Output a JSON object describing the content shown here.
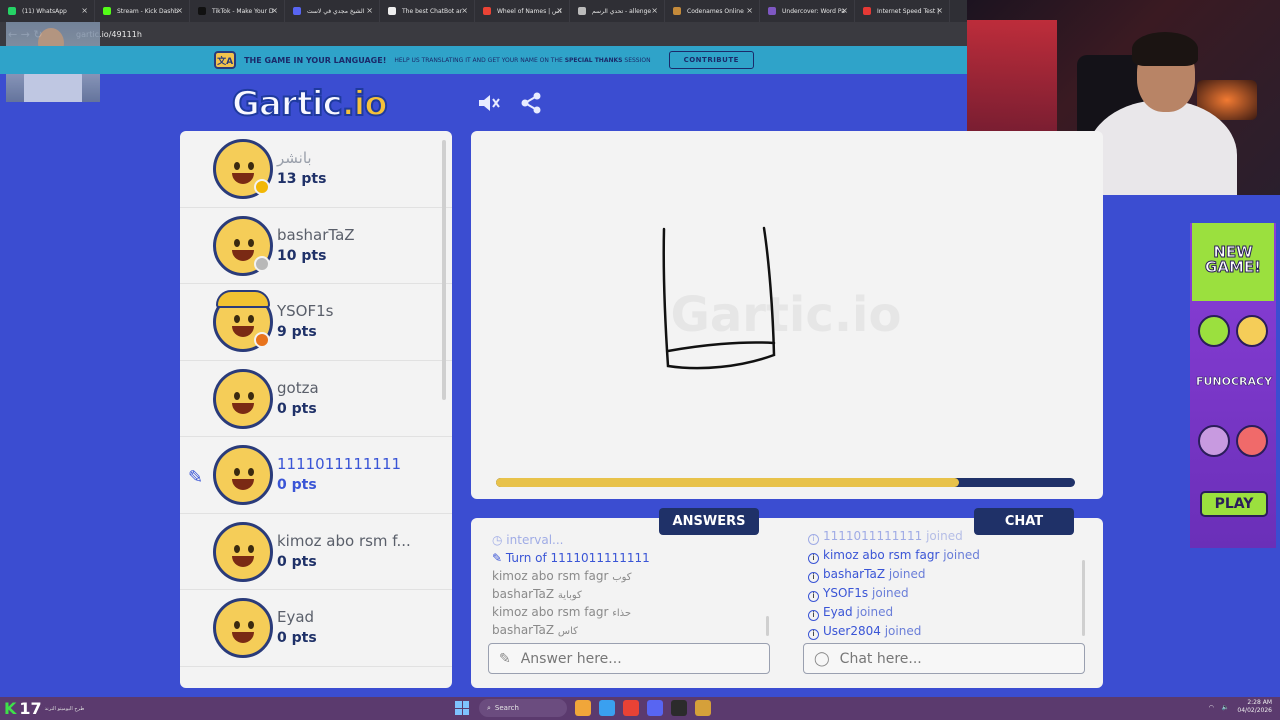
{
  "browser": {
    "tabs": [
      {
        "label": "(11) WhatsApp",
        "color": "#25d366"
      },
      {
        "label": "Stream - Kick Dashb",
        "color": "#53fc18"
      },
      {
        "label": "TikTok - Make Your D",
        "color": "#111111"
      },
      {
        "label": "الشيخ مجدي في لاست",
        "color": "#5865f2"
      },
      {
        "label": "The best ChatBot ar",
        "color": "#eeeeee"
      },
      {
        "label": "Wheel of Names | اس",
        "color": "#ea4335"
      },
      {
        "label": "تحدي الرسم - allenge",
        "color": "#bbbbbb"
      },
      {
        "label": "Codenames Online",
        "color": "#c48a3a"
      },
      {
        "label": "Undercover: Word Pa",
        "color": "#7e57c2"
      },
      {
        "label": "Internet Speed Test |",
        "color": "#e53935"
      }
    ],
    "url": "gartic.io/49111h"
  },
  "banner": {
    "title": "THE GAME IN YOUR LANGUAGE!",
    "text_before": "HELP US TRANSLATING IT AND GET YOUR NAME ON THE",
    "text_bold": "SPECIAL THANKS",
    "text_after": "SESSION",
    "button": "CONTRIBUTE"
  },
  "header": {
    "logo_main": "Gartic",
    "logo_suffix": ".io",
    "sound_icon": "speaker-mute-icon",
    "share_icon": "share-icon"
  },
  "players": [
    {
      "name": "بانشر",
      "points": "13 pts",
      "status_color": "#f2b705",
      "drawing": false,
      "faded": true
    },
    {
      "name": "basharTaZ",
      "points": "10 pts",
      "status_color": "#b8b8b8",
      "drawing": false
    },
    {
      "name": "YSOF1s",
      "points": "9 pts",
      "status_color": "#e8731c",
      "drawing": false,
      "cap": true
    },
    {
      "name": "gotza",
      "points": "0 pts",
      "status_color": "",
      "drawing": false
    },
    {
      "name": "1111011111111",
      "points": "0 pts",
      "status_color": "",
      "drawing": true
    },
    {
      "name": "kimoz abo rsm f...",
      "points": "0 pts",
      "status_color": "",
      "drawing": false
    },
    {
      "name": "Eyad",
      "points": "0 pts",
      "status_color": "",
      "drawing": false
    }
  ],
  "canvas": {
    "watermark": "Gartic.io",
    "timer_progress": 0.8
  },
  "answers": {
    "tab_label": "ANSWERS",
    "messages": [
      {
        "type": "sys-faded",
        "text": "interval..."
      },
      {
        "type": "sys",
        "text": "Turn of 1111011111111"
      },
      {
        "type": "guess",
        "name": "kimoz abo rsm fagr",
        "guess": "كوب"
      },
      {
        "type": "guess",
        "name": "basharTaZ",
        "guess": "كوباية"
      },
      {
        "type": "guess",
        "name": "kimoz abo rsm fagr",
        "guess": "حذاء"
      },
      {
        "type": "guess",
        "name": "basharTaZ",
        "guess": "كاس"
      }
    ],
    "placeholder": "Answer here..."
  },
  "chat": {
    "tab_label": "CHAT",
    "joined_word": "joined",
    "messages": [
      {
        "name": "1111011111111",
        "faded": true
      },
      {
        "name": "kimoz abo rsm fagr"
      },
      {
        "name": "basharTaZ"
      },
      {
        "name": "YSOF1s"
      },
      {
        "name": "Eyad"
      },
      {
        "name": "User2804"
      }
    ],
    "placeholder": "Chat here..."
  },
  "ad": {
    "headline_1": "NEW",
    "headline_2": "GAME!",
    "brand": "FUNOCRACY",
    "cta": "PLAY"
  },
  "taskbar": {
    "badge": "17",
    "badge_caption": "طرح اليوميتو الترند",
    "search": "Search",
    "time": "2:28 AM",
    "date": "04/02/2026"
  },
  "colors": {
    "page_bg": "#3b4dd1",
    "navy": "#1f3168",
    "accent_blue": "#3a55d6",
    "gold": "#e8c24a"
  }
}
